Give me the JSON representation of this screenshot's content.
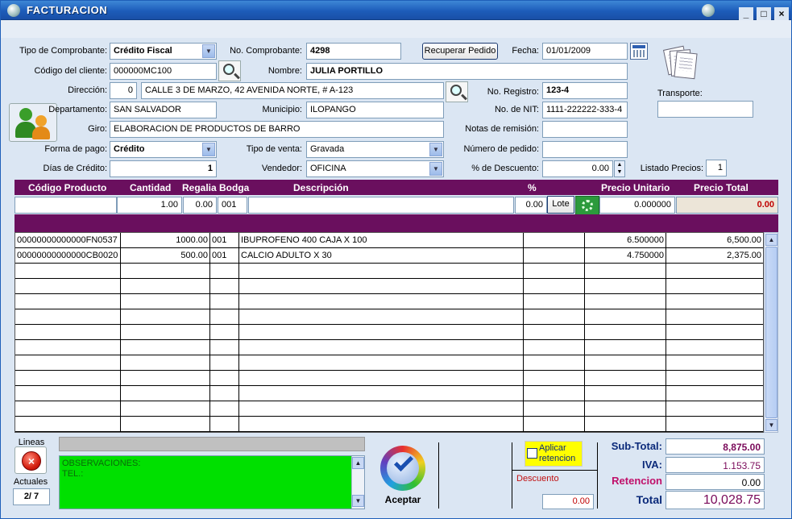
{
  "window": {
    "title": "FACTURACION",
    "minimize": "_",
    "maximize": "□",
    "close": "×"
  },
  "header": {
    "tipo_comprobante": {
      "label": "Tipo de Comprobante:",
      "value": "Crédito Fiscal"
    },
    "no_comprobante": {
      "label": "No. Comprobante:",
      "value": "4298"
    },
    "recuperar_pedido": "Recuperar Pedido",
    "fecha": {
      "label": "Fecha:",
      "value": "01/01/2009"
    },
    "codigo_cliente": {
      "label": "Código del cliente:",
      "value": "000000MC100"
    },
    "nombre": {
      "label": "Nombre:",
      "value": "JULIA PORTILLO"
    },
    "direccion": {
      "label": "Dirección:",
      "num": "0",
      "value": "CALLE 3 DE MARZO, 42 AVENIDA NORTE, # A-123"
    },
    "no_registro": {
      "label": "No. Registro:",
      "value": "123-4"
    },
    "transporte": {
      "label": "Transporte:",
      "value": ""
    },
    "departamento": {
      "label": "Departamento:",
      "value": "SAN SALVADOR"
    },
    "municipio": {
      "label": "Municipio:",
      "value": "ILOPANGO"
    },
    "no_nit": {
      "label": "No. de NIT:",
      "value": "1111-222222-333-4"
    },
    "giro": {
      "label": "Giro:",
      "value": "ELABORACION DE PRODUCTOS DE BARRO"
    },
    "notas_remision": {
      "label": "Notas de remisión:",
      "value": ""
    },
    "forma_pago": {
      "label": "Forma de pago:",
      "value": "Crédito"
    },
    "tipo_venta": {
      "label": "Tipo de venta:",
      "value": "Gravada"
    },
    "numero_pedido": {
      "label": "Número de pedido:",
      "value": ""
    },
    "dias_credito": {
      "label": "Días de Crédito:",
      "value": "1"
    },
    "vendedor": {
      "label": "Vendedor:",
      "value": "OFICINA"
    },
    "descuento_pct": {
      "label": "% de Descuento:",
      "value": "0.00"
    },
    "listado_precios": {
      "label": "Listado Precios:",
      "value": "1"
    }
  },
  "grid": {
    "columns": [
      "Código Producto",
      "Cantidad",
      "Regalia",
      "Bodga",
      "Descripción",
      "%",
      "Precio Unitario",
      "Precio Total"
    ],
    "entry": {
      "codigo": "",
      "cantidad": "1.00",
      "regalia": "0.00",
      "bodega": "001",
      "descripcion": "",
      "pct": "0.00",
      "lote": "Lote",
      "precio_unitario": "0.000000",
      "precio_total": "0.00"
    },
    "rows": [
      {
        "codigo": "00000000000000FN0537",
        "cantidad": "1000.00",
        "bodega": "001",
        "descripcion": "IBUPROFENO 400 CAJA X 100",
        "pct": "",
        "precio_unitario": "6.500000",
        "precio_total": "6,500.00"
      },
      {
        "codigo": "00000000000000CB0020",
        "cantidad": "500.00",
        "bodega": "001",
        "descripcion": "CALCIO ADULTO X 30",
        "pct": "",
        "precio_unitario": "4.750000",
        "precio_total": "2,375.00"
      }
    ]
  },
  "footer": {
    "lineas_label": "Lineas",
    "actuales_label": "Actuales",
    "counter": "2/ 7",
    "observaciones": "OBSERVACIONES:\nTEL.:",
    "aceptar": "Aceptar",
    "aplicar_retencion": "Aplicar\nretencion",
    "descuento_label": "Descuento",
    "descuento_value": "0.00",
    "subtotal": {
      "label": "Sub-Total:",
      "value": "8,875.00"
    },
    "iva": {
      "label": "IVA:",
      "value": "1.153.75"
    },
    "retencion": {
      "label": "Retencion",
      "value": "0.00"
    },
    "total": {
      "label": "Total",
      "value": "10,028.75"
    }
  },
  "colors": {
    "grid_header": "#6a0f5e",
    "observaciones_bg": "#00e000",
    "retencion_label": "#c0106a",
    "label_blue": "#0b2a7a"
  }
}
